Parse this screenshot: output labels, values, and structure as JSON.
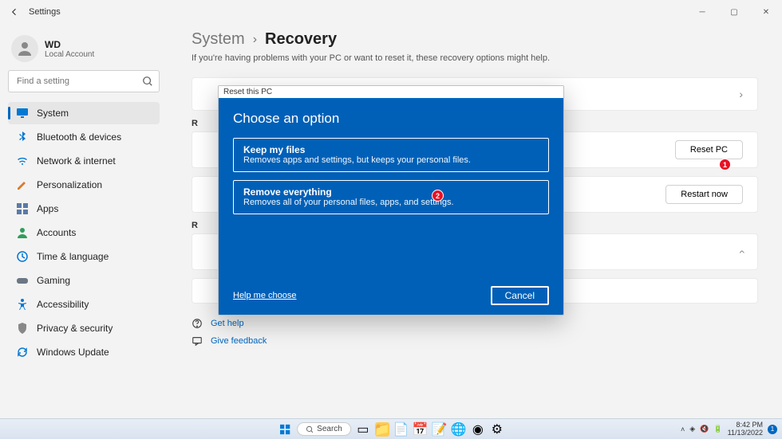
{
  "window": {
    "title": "Settings"
  },
  "profile": {
    "name": "WD",
    "sub": "Local Account"
  },
  "search": {
    "placeholder": "Find a setting"
  },
  "nav": {
    "items": [
      {
        "label": "System",
        "icon": "monitor",
        "active": true
      },
      {
        "label": "Bluetooth & devices",
        "icon": "bluetooth"
      },
      {
        "label": "Network & internet",
        "icon": "wifi"
      },
      {
        "label": "Personalization",
        "icon": "brush"
      },
      {
        "label": "Apps",
        "icon": "apps"
      },
      {
        "label": "Accounts",
        "icon": "user"
      },
      {
        "label": "Time & language",
        "icon": "clock"
      },
      {
        "label": "Gaming",
        "icon": "game"
      },
      {
        "label": "Accessibility",
        "icon": "accessibility"
      },
      {
        "label": "Privacy & security",
        "icon": "shield"
      },
      {
        "label": "Windows Update",
        "icon": "update"
      }
    ]
  },
  "breadcrumb": {
    "parent": "System",
    "current": "Recovery"
  },
  "subtitle": "If you're having problems with your PC or want to reset it, these recovery options might help.",
  "actions": {
    "reset": "Reset PC",
    "restart": "Restart now"
  },
  "section_labels": {
    "r1": "R",
    "r2": "R"
  },
  "help": {
    "get": "Get help",
    "feedback": "Give feedback"
  },
  "dialog": {
    "title": "Reset this PC",
    "heading": "Choose an option",
    "opt1": {
      "title": "Keep my files",
      "desc": "Removes apps and settings, but keeps your personal files."
    },
    "opt2": {
      "title": "Remove everything",
      "desc": "Removes all of your personal files, apps, and settings."
    },
    "help": "Help me choose",
    "cancel": "Cancel"
  },
  "annotations": {
    "a1": "1",
    "a2": "2"
  },
  "taskbar": {
    "search": "Search",
    "time": "8:42 PM",
    "date": "11/13/2022",
    "badge": "1"
  }
}
